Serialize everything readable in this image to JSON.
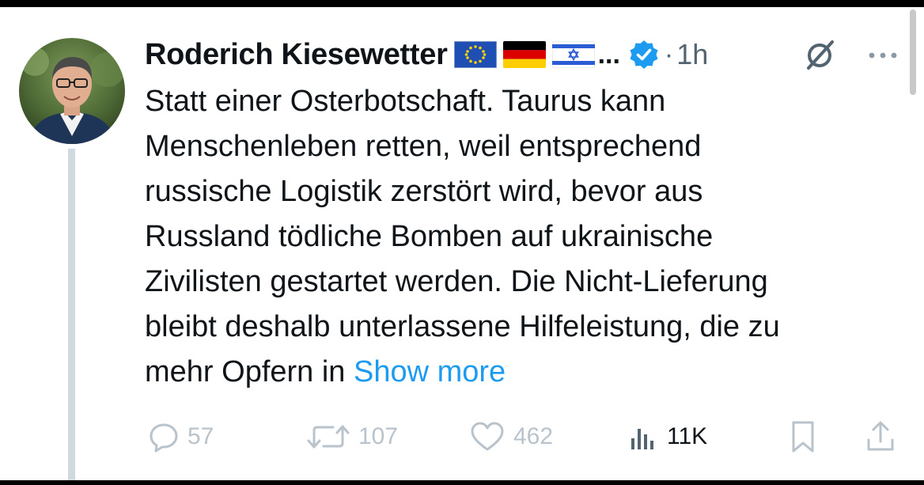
{
  "author": {
    "name": "Roderich Kiesewetter",
    "name_suffix": "...",
    "verified": true,
    "flags": [
      "eu-flag-icon",
      "germany-flag-icon",
      "israel-flag-icon"
    ]
  },
  "meta": {
    "separator": "·",
    "time": "1h"
  },
  "tweet": {
    "lines": [
      "Statt einer Osterbotschaft. Taurus kann",
      "Menschenleben retten, weil entsprechend",
      "russische Logistik zerstört wird, bevor aus",
      "Russland tödliche Bomben auf ukrainische",
      "Zivilisten gestartet werden. Die Nicht-Lieferung",
      "bleibt deshalb unterlassene Hilfeleistung, die zu",
      "mehr Opfern in "
    ],
    "show_more": "Show more"
  },
  "actions": {
    "replies": "57",
    "reposts": "107",
    "likes": "462",
    "views": "11K"
  },
  "colors": {
    "text": "#0f1419",
    "secondary": "#536471",
    "link": "#1d9bf0",
    "verified": "#1d9bf0",
    "faded_action": "#b9c3cb",
    "thread_line": "#cfd9de"
  }
}
